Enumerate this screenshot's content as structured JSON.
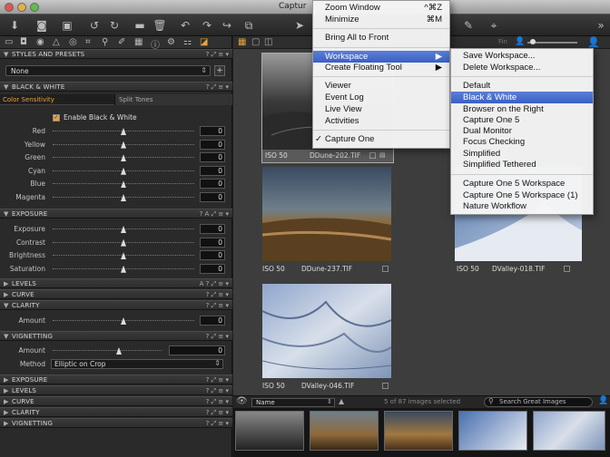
{
  "window": {
    "title": "Captur"
  },
  "panel": {
    "sections": {
      "styles_presets": "STYLES AND PRESETS",
      "style_value": "None",
      "black_white": "BLACK & WHITE",
      "tab_color_sensitivity": "Color Sensitivity",
      "tab_split_tones": "Split Tones",
      "enable_bw": "Enable Black & White",
      "exposure": "EXPOSURE",
      "levels": "LEVELS",
      "curve": "CURVE",
      "clarity": "CLARITY",
      "vignetting": "VIGNETTING",
      "method_label": "Method",
      "method_value": "Elliptic on Crop"
    },
    "bw_rows": [
      {
        "label": "Red",
        "value": "0"
      },
      {
        "label": "Yellow",
        "value": "0"
      },
      {
        "label": "Green",
        "value": "0"
      },
      {
        "label": "Cyan",
        "value": "0"
      },
      {
        "label": "Blue",
        "value": "0"
      },
      {
        "label": "Magenta",
        "value": "0"
      }
    ],
    "exposure_rows": [
      {
        "label": "Exposure",
        "value": "0"
      },
      {
        "label": "Contrast",
        "value": "0"
      },
      {
        "label": "Brightness",
        "value": "0"
      },
      {
        "label": "Saturation",
        "value": "0"
      }
    ],
    "clarity_row": {
      "label": "Amount",
      "value": "0"
    },
    "vignetting_row": {
      "label": "Amount",
      "value": "0"
    },
    "bottom_sections": [
      "EXPOSURE",
      "LEVELS",
      "CURVE",
      "CLARITY",
      "VIGNETTING"
    ]
  },
  "viewer": {
    "search_label": "Fin",
    "thumbs": [
      {
        "iso": "ISO 50",
        "name": "DDune-202.TIF"
      },
      {
        "iso": "ISO 50",
        "name": "DDune-237.TIF"
      },
      {
        "iso": "ISO 50",
        "name": "DValley-018.TIF"
      },
      {
        "iso": "ISO 50",
        "name": "DValley-046.TIF"
      }
    ]
  },
  "window_menu": {
    "items": [
      {
        "label": "Zoom Window",
        "shortcut": "^⌘Z"
      },
      {
        "label": "Minimize",
        "shortcut": "⌘M"
      },
      {
        "label": "Bring All to Front",
        "shortcut": ""
      },
      {
        "label": "Workspace",
        "shortcut": "▶"
      },
      {
        "label": "Create Floating Tool",
        "shortcut": "▶"
      },
      {
        "label": "Viewer",
        "shortcut": ""
      },
      {
        "label": "Event Log",
        "shortcut": ""
      },
      {
        "label": "Live View",
        "shortcut": ""
      },
      {
        "label": "Activities",
        "shortcut": ""
      },
      {
        "label": "Capture One",
        "shortcut": ""
      }
    ],
    "checkmark": "✓"
  },
  "workspace_menu": {
    "items": [
      "Save Workspace...",
      "Delete Workspace...",
      "Default",
      "Black & White",
      "Browser on the Right",
      "Capture One 5",
      "Dual Monitor",
      "Focus Checking",
      "Simplified",
      "Simplified Tethered",
      "Capture One 5 Workspace",
      "Capture One 5 Workspace (1)",
      "Nature Workflow"
    ]
  },
  "filmstrip": {
    "sort_label": "Name",
    "count": "5 of 87 images selected",
    "search_placeholder": "Search Great Images"
  },
  "colors": {
    "accent": "#3a5fc6",
    "panel": "#2a2a2a",
    "viewer": "#3d3d3d"
  }
}
